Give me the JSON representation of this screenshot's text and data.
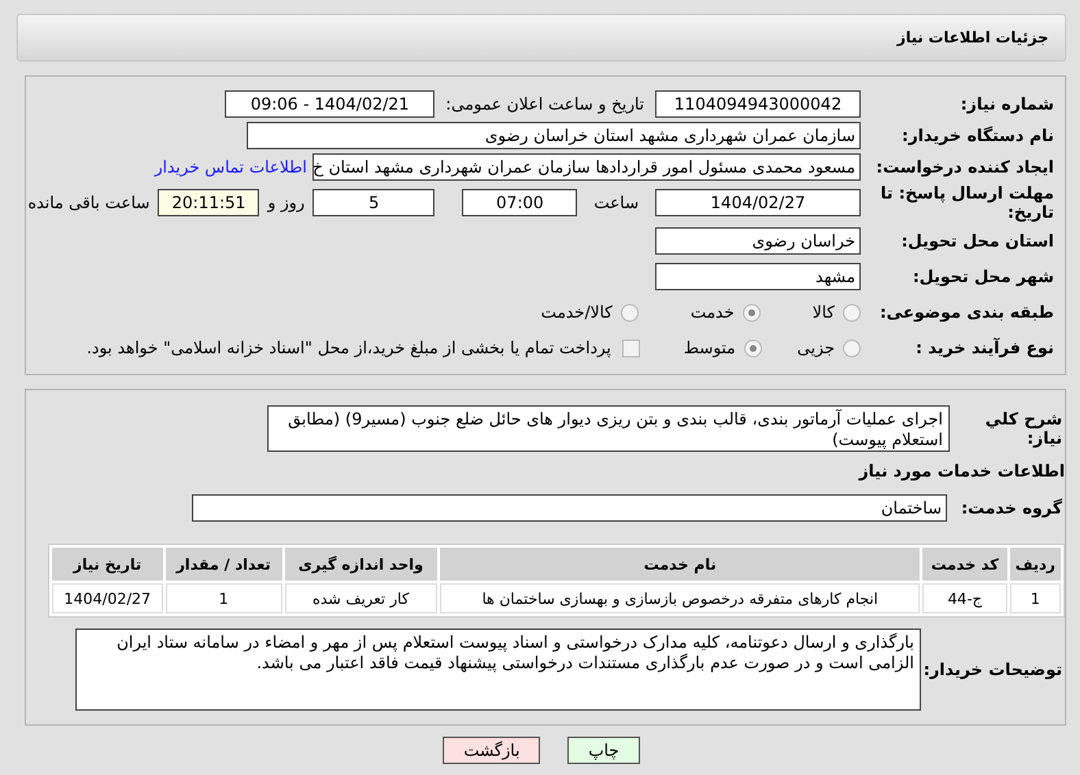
{
  "header": {
    "title": "جزئیات اطلاعات نیاز"
  },
  "details": {
    "need_number": {
      "label": "شماره نیاز:",
      "value": "1104094943000042"
    },
    "announce": {
      "label": "تاریخ و ساعت اعلان عمومی:",
      "value": "1404/02/21 - 09:06"
    },
    "buyer": {
      "label": "نام دستگاه خریدار:",
      "value": "سازمان عمران شهرداری مشهد استان خراسان رضوی"
    },
    "requester": {
      "label": "ایجاد کننده درخواست:",
      "value": "مسعود محمدی مسئول امور قراردادها سازمان عمران شهرداری مشهد استان خ",
      "link": "اطلاعات تماس خریدار"
    },
    "deadline": {
      "label": "مهلت ارسال پاسخ: تا تاریخ:",
      "date": "1404/02/27",
      "time_label": "ساعت",
      "time": "07:00",
      "days": "5",
      "days_label": "روز و",
      "remaining": "20:11:51",
      "remaining_label": "ساعت باقی مانده"
    },
    "province": {
      "label": "استان محل تحویل:",
      "value": "خراسان رضوی"
    },
    "city": {
      "label": "شهر محل تحویل:",
      "value": "مشهد"
    },
    "category": {
      "label": "طبقه بندی موضوعی:",
      "options": [
        {
          "label": "کالا",
          "selected": false
        },
        {
          "label": "خدمت",
          "selected": true
        },
        {
          "label": "کالا/خدمت",
          "selected": false
        }
      ]
    },
    "process": {
      "label": "نوع فرآیند خرید :",
      "options": [
        {
          "label": "جزیی",
          "selected": false
        },
        {
          "label": "متوسط",
          "selected": true
        }
      ],
      "payment": {
        "label": "پرداخت تمام یا بخشی از مبلغ خرید،از محل \"اسناد خزانه اسلامی\" خواهد بود.",
        "checked": false
      }
    }
  },
  "services": {
    "summary": {
      "label": "شرح کلي نياز:",
      "value": "اجرای عملیات آرماتور بندی، قالب بندی و بتن ریزی دیوار های حائل ضلع جنوب (مسیر9)  (مطابق استعلام پیوست)"
    },
    "heading": "اطلاعات خدمات مورد نیاز",
    "group": {
      "label": "گروه خدمت:",
      "value": "ساختمان"
    },
    "table": {
      "columns": [
        "ردیف",
        "کد خدمت",
        "نام خدمت",
        "واحد اندازه گیری",
        "تعداد / مقدار",
        "تاریخ نیاز"
      ],
      "rows": [
        [
          "1",
          "ج-44",
          "انجام کارهای متفرقه درخصوص بازسازی و بهسازی ساختمان ها",
          "کار تعریف شده",
          "1",
          "1404/02/27"
        ]
      ]
    },
    "notes": {
      "label": "توضیحات خریدار:",
      "value": "بارگذاری و ارسال دعوتنامه، کلیه مدارک درخواستی و اسناد پیوست استعلام پس از مهر و امضاء در سامانه ستاد ایران الزامی است و در صورت عدم بارگذاری مستندات درخواستی پیشنهاد قیمت فاقد اعتبار می باشد."
    }
  },
  "buttons": [
    {
      "label": "چاپ",
      "kind": "print"
    },
    {
      "label": "بازگشت",
      "kind": "back"
    }
  ]
}
